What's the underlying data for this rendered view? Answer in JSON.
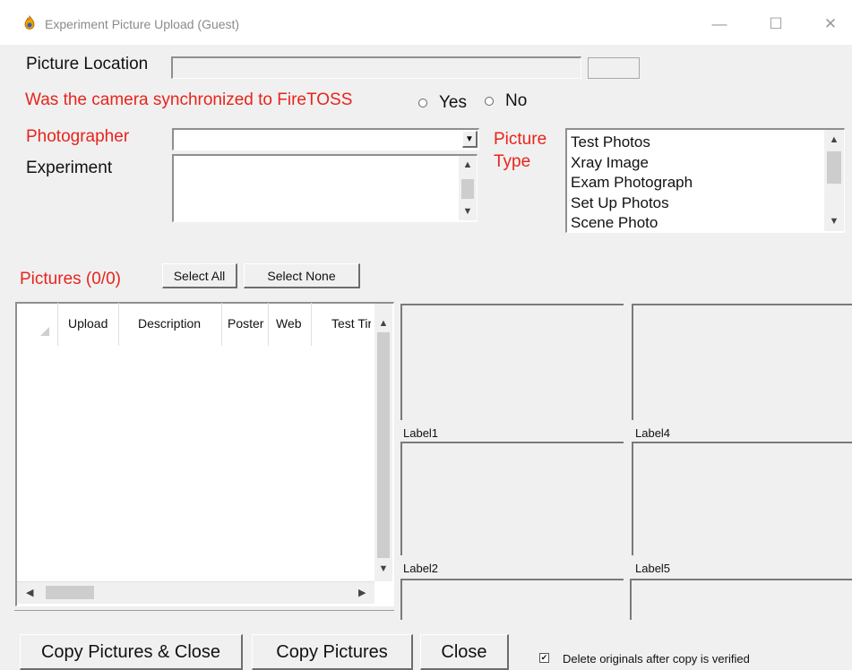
{
  "window": {
    "title": "Experiment Picture Upload (Guest)",
    "minimize_glyph": "—",
    "maximize_glyph": "☐",
    "close_glyph": "✕"
  },
  "form": {
    "picture_location_label": "Picture Location",
    "picture_location_value": "",
    "sync_question": "Was the camera synchronized to FireTOSS",
    "sync_yes": "Yes",
    "sync_no": "No",
    "photographer_label": "Photographer",
    "photographer_value": "",
    "experiment_label": "Experiment",
    "experiment_value": "",
    "picture_type_label_1": "Picture",
    "picture_type_label_2": "Type",
    "picture_types": [
      "Test Photos",
      "Xray Image",
      "Exam Photograph",
      "Set Up Photos",
      "Scene Photo"
    ]
  },
  "pictures": {
    "heading": "Pictures (0/0)",
    "select_all": "Select All",
    "select_none": "Select None",
    "columns": [
      "Upload",
      "Description",
      "Poster",
      "Web",
      "Test Tir"
    ]
  },
  "previews": {
    "labels": [
      "Label1",
      "Label4",
      "Label2",
      "Label5"
    ]
  },
  "footer": {
    "copy_close": "Copy Pictures & Close",
    "copy": "Copy Pictures",
    "close": "Close",
    "delete_originals": "Delete originals after copy is verified",
    "delete_originals_checked": true,
    "check_glyph": "✔"
  },
  "colors": {
    "accent_red": "#e8241c",
    "window_bg": "#f0f0f0"
  },
  "icons": {
    "app": "flame-icon",
    "dropdown": "chevron-down-icon"
  }
}
